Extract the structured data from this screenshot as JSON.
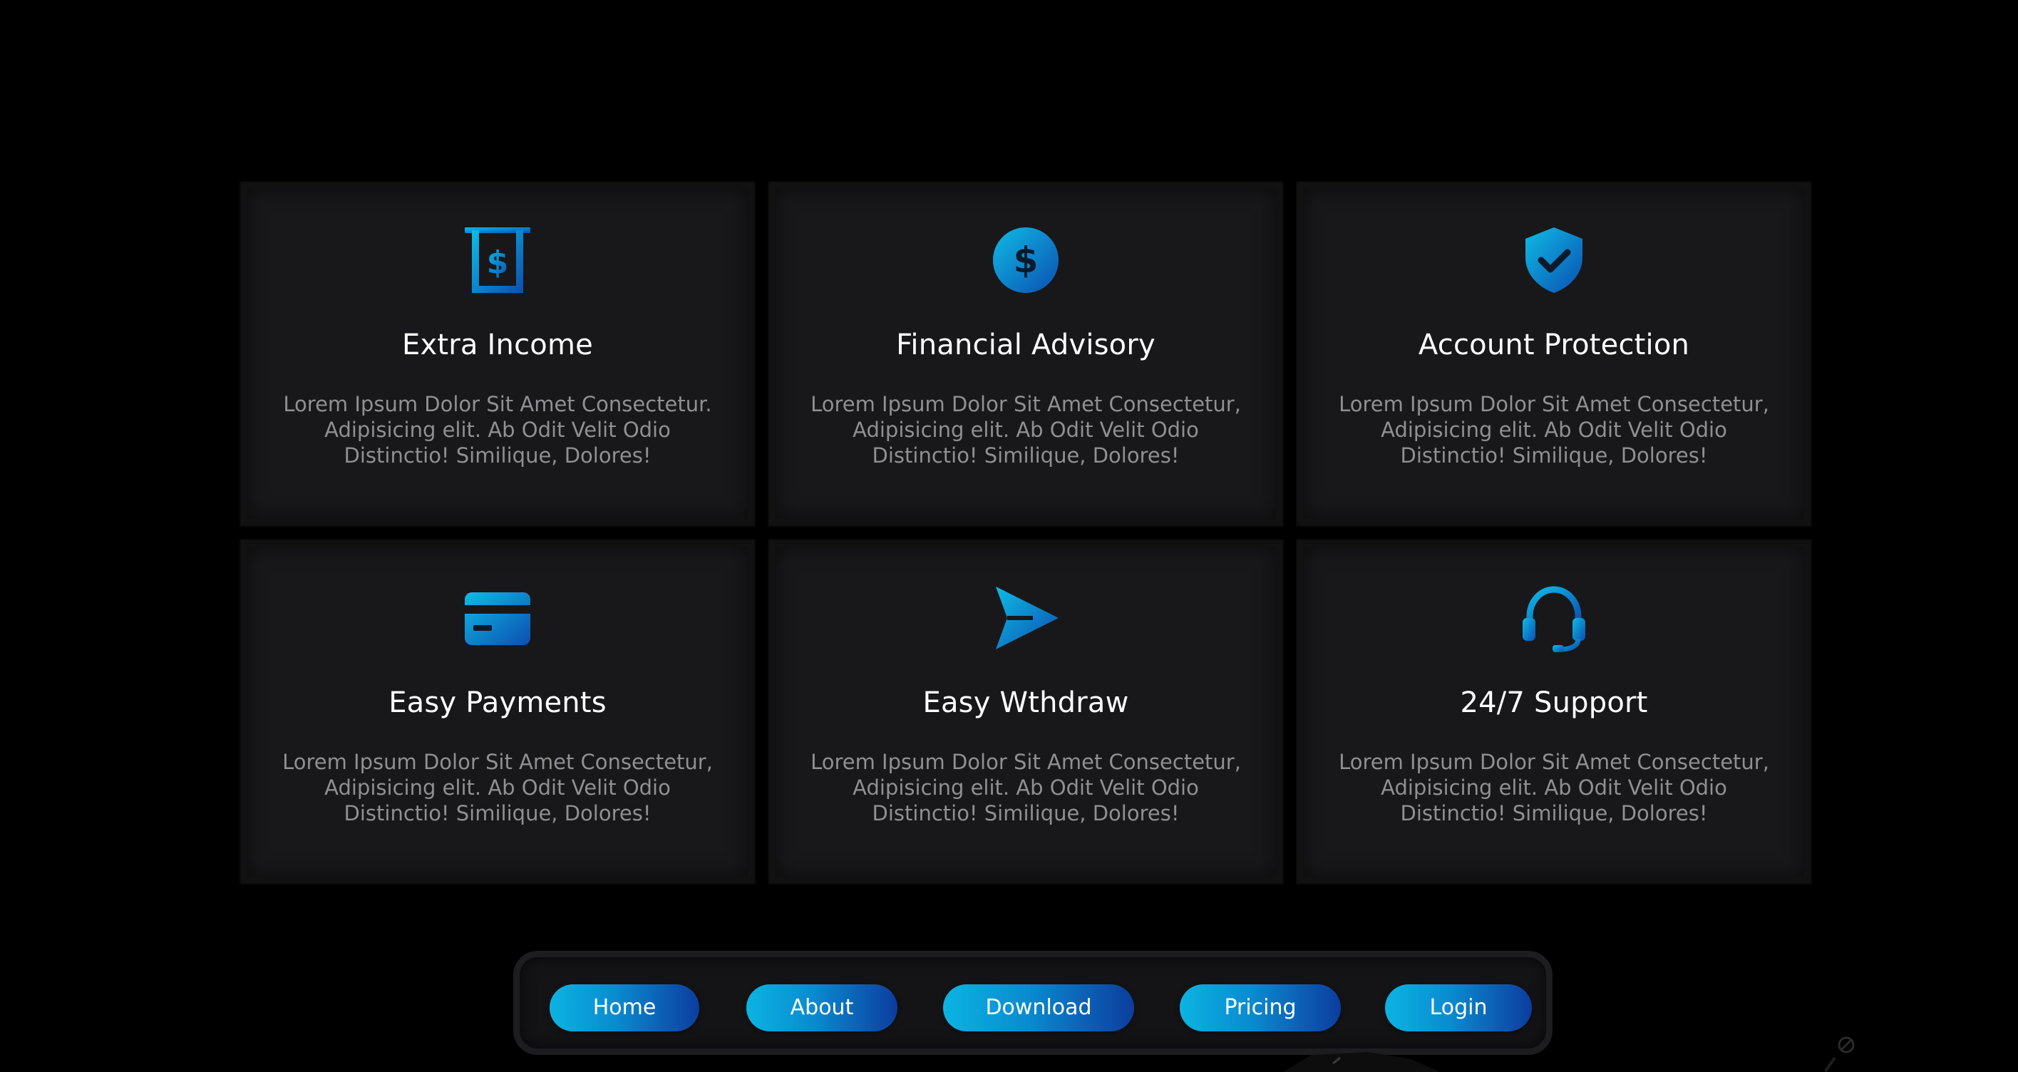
{
  "cards": [
    {
      "icon": "dollar-receipt-icon",
      "title": "Extra Income",
      "description": "Lorem Ipsum Dolor Sit Amet Consectetur. Adipisicing elit. Ab Odit Velit Odio Distinctio! Similique, Dolores!"
    },
    {
      "icon": "dollar-circle-icon",
      "title": "Financial Advisory",
      "description": "Lorem Ipsum Dolor Sit Amet Consectetur, Adipisicing elit. Ab Odit Velit Odio Distinctio! Similique, Dolores!"
    },
    {
      "icon": "shield-check-icon",
      "title": "Account Protection",
      "description": "Lorem Ipsum Dolor Sit Amet Consectetur, Adipisicing elit. Ab Odit Velit Odio Distinctio! Similique, Dolores!"
    },
    {
      "icon": "credit-card-icon",
      "title": "Easy Payments",
      "description": "Lorem Ipsum Dolor Sit Amet Consectetur, Adipisicing elit. Ab Odit Velit Odio Distinctio! Similique, Dolores!"
    },
    {
      "icon": "send-arrow-icon",
      "title": "Easy Wthdraw",
      "description": "Lorem Ipsum Dolor Sit Amet Consectetur, Adipisicing elit. Ab Odit Velit Odio Distinctio! Similique, Dolores!"
    },
    {
      "icon": "headset-icon",
      "title": "24/7 Support",
      "description": "Lorem Ipsum Dolor Sit Amet Consectetur, Adipisicing elit. Ab Odit Velit Odio Distinctio! Similique, Dolores!"
    }
  ],
  "nav": {
    "items": [
      {
        "label": "Home"
      },
      {
        "label": "About"
      },
      {
        "label": "Download"
      },
      {
        "label": "Pricing"
      },
      {
        "label": "Login"
      }
    ]
  },
  "colors": {
    "background": "#000000",
    "card": "#18181a",
    "accent_start": "#0bb4e2",
    "accent_end": "#0c3d9e",
    "title": "#ffffff",
    "description": "#8f8f94"
  }
}
